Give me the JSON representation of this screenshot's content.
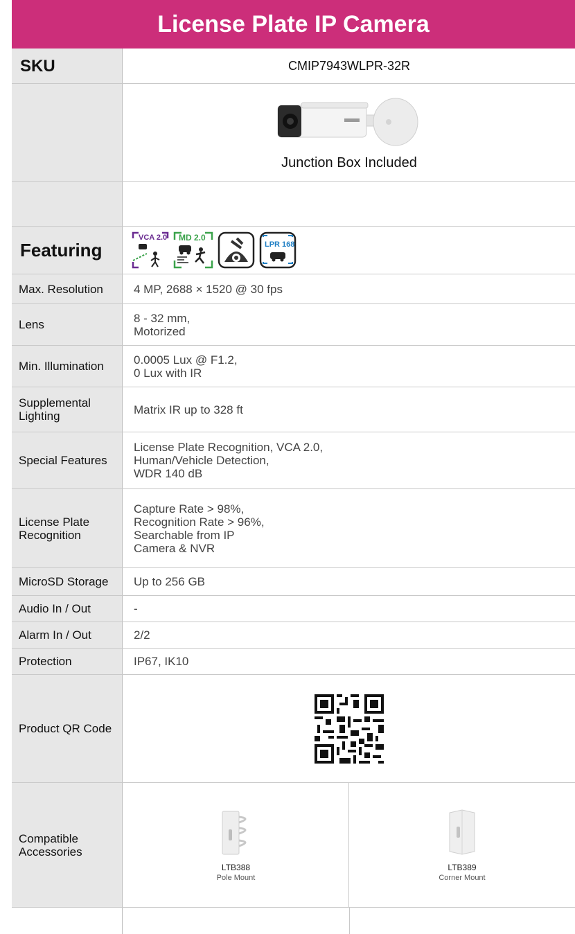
{
  "title": "License Plate IP Camera",
  "sku": {
    "label": "SKU",
    "value": "CMIP7943WLPR-32R"
  },
  "image_caption": "Junction Box Included",
  "featuring": {
    "label": "Featuring",
    "badges": [
      "VCA 2.0",
      "MD 2.0",
      "LPR 168"
    ]
  },
  "specs": [
    {
      "label": "Max. Resolution",
      "value": "4 MP, 2688 × 1520 @ 30 fps"
    },
    {
      "label": "Lens",
      "value": "8 - 32 mm,\nMotorized"
    },
    {
      "label": "Min. Illumination",
      "value": "0.0005 Lux @ F1.2,\n0 Lux with IR"
    },
    {
      "label": "Supplemental\nLighting",
      "value": "Matrix IR up to 328 ft"
    },
    {
      "label": "Special Features",
      "value": "License Plate Recognition, VCA 2.0,\nHuman/Vehicle Detection,\nWDR 140 dB"
    },
    {
      "label": "License Plate\nRecognition",
      "value": "Capture Rate > 98%,\nRecognition Rate > 96%,\nSearchable from IP\nCamera & NVR"
    },
    {
      "label": "MicroSD Storage",
      "value": "Up to 256 GB"
    },
    {
      "label": "Audio In / Out",
      "value": "-"
    },
    {
      "label": "Alarm In / Out",
      "value": "2/2"
    },
    {
      "label": "Protection",
      "value": "IP67, IK10"
    }
  ],
  "qr_label": "Product QR Code",
  "accessories": {
    "label": "Compatible\nAccessories",
    "items": [
      {
        "code": "LTB388",
        "name": "Pole Mount"
      },
      {
        "code": "LTB389",
        "name": "Corner Mount"
      }
    ]
  },
  "colors": {
    "brand": "#cc2e7a",
    "label_bg": "#e7e7e7"
  }
}
